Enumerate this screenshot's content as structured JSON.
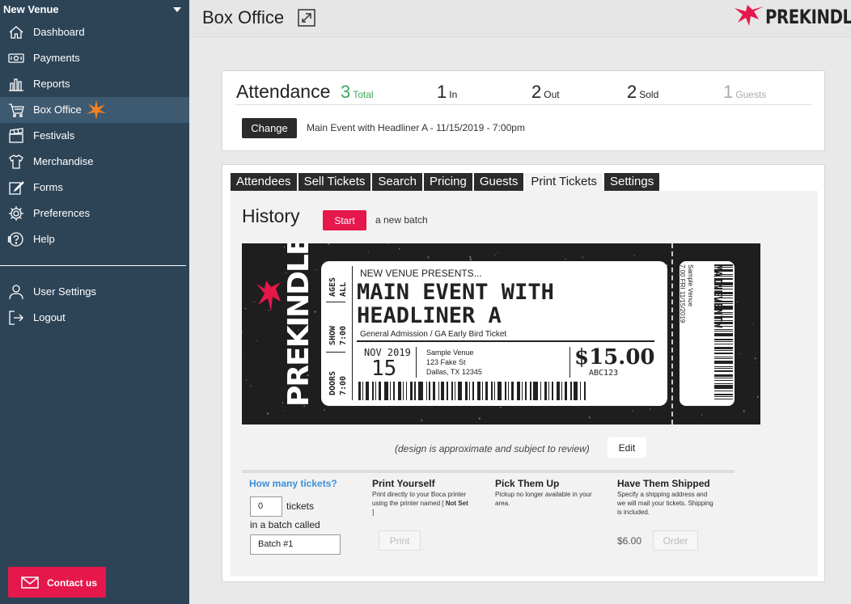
{
  "sidebar": {
    "venue": "New Venue",
    "items": [
      {
        "label": "Dashboard",
        "icon": "home-icon"
      },
      {
        "label": "Payments",
        "icon": "payments-icon"
      },
      {
        "label": "Reports",
        "icon": "bar-chart-icon"
      },
      {
        "label": "Box Office",
        "icon": "cart-icon",
        "active": true
      },
      {
        "label": "Festivals",
        "icon": "clapperboard-icon"
      },
      {
        "label": "Merchandise",
        "icon": "tshirt-icon"
      },
      {
        "label": "Forms",
        "icon": "edit-form-icon"
      },
      {
        "label": "Preferences",
        "icon": "gear-icon"
      },
      {
        "label": "Help",
        "icon": "help-icon"
      }
    ],
    "user_items": [
      {
        "label": "User Settings",
        "icon": "user-icon"
      },
      {
        "label": "Logout",
        "icon": "logout-icon"
      }
    ],
    "contact_label": "Contact us"
  },
  "header": {
    "title": "Box Office",
    "brand": "PREKINDLE"
  },
  "attendance": {
    "title": "Attendance",
    "stats": [
      {
        "value": "3",
        "label": "Total",
        "color": "#3aa65c"
      },
      {
        "value": "1",
        "label": "In",
        "color": "#222222"
      },
      {
        "value": "2",
        "label": "Out",
        "color": "#222222"
      },
      {
        "value": "2",
        "label": "Sold",
        "color": "#222222"
      },
      {
        "value": "1",
        "label": "Guests",
        "color": "#aaaaaa"
      }
    ],
    "change_label": "Change",
    "event": "Main Event with Headliner A - 11/15/2019 - 7:00pm"
  },
  "tabs": [
    "Attendees",
    "Sell Tickets",
    "Search",
    "Pricing",
    "Guests",
    "Print Tickets",
    "Settings"
  ],
  "active_tab": "Print Tickets",
  "history": {
    "title": "History",
    "start_label": "Start",
    "batch_text": "a new batch"
  },
  "ticket": {
    "ages": "AGES",
    "ages_value": "ALL",
    "show": "SHOW",
    "show_time": "7:00",
    "doors": "DOORS",
    "doors_time": "7:00",
    "presents": "NEW VENUE PRESENTS...",
    "event_line1": "MAIN EVENT WITH",
    "event_line2": "HEADLINER A",
    "ticket_type": "General Admission / GA Early Bird Ticket",
    "month": "NOV 2019",
    "day": "15",
    "venue_name": "Sample Venue",
    "venue_street": "123 Fake St",
    "venue_city": "Dallas, TX 12345",
    "price": "$15.00",
    "code": "ABC123",
    "logo_text": "PREKINDLE",
    "stub_title": "MAINEVENTW",
    "stub_venue": "Sample Venue",
    "stub_date": "7:00 FRI 11/15/2019",
    "stub_presenter": "New Venue"
  },
  "design_note": "(design is approximate and subject to review)",
  "edit_label": "Edit",
  "options": {
    "how_many": "How many tickets?",
    "qty": "0",
    "tickets_label": "tickets",
    "batch_label": "in a batch called",
    "batch_value": "Batch #1",
    "print_yourself": {
      "title": "Print Yourself",
      "desc1": "Print directly to your Boca printer",
      "desc2": "using the printer named [",
      "desc_bold": "Not Set",
      "desc3": "]",
      "button": "Print"
    },
    "pick_up": {
      "title": "Pick Them Up",
      "desc1": "Pickup no longer available in your",
      "desc2": "area."
    },
    "shipped": {
      "title": "Have Them Shipped",
      "desc1": "Specify a shipping address and",
      "desc2": "we will mail your tickets. Shipping",
      "desc3": "is included.",
      "price": "$6.00",
      "button": "Order"
    }
  }
}
